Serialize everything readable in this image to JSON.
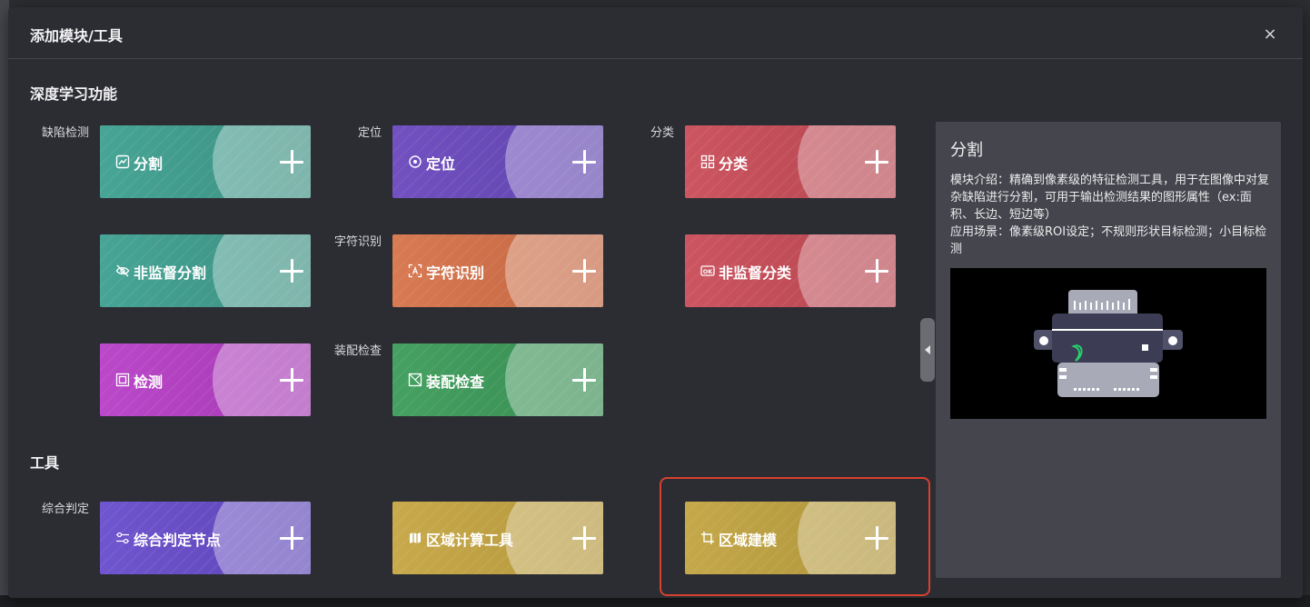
{
  "dialog": {
    "title": "添加模块/工具",
    "close_label": "×"
  },
  "sections": {
    "deep_learning": "深度学习功能",
    "tools": "工具"
  },
  "groups": {
    "defect": "缺陷检测",
    "locate": "定位",
    "classify": "分类",
    "ocr": "字符识别",
    "assembly": "装配检查",
    "judge": "综合判定"
  },
  "cards": {
    "segment": {
      "label": "分割",
      "icon": "segment-icon",
      "color": "#3f9b8c"
    },
    "locate": {
      "label": "定位",
      "icon": "target-icon",
      "color": "#6b4fb8"
    },
    "classify": {
      "label": "分类",
      "icon": "grid-icon",
      "color": "#c44d57"
    },
    "unsup_segment": {
      "label": "非监督分割",
      "icon": "eye-off-icon",
      "color": "#3f9b8c"
    },
    "ocr": {
      "label": "字符识别",
      "icon": "text-scan-icon",
      "color": "#d66f47"
    },
    "unsup_classify": {
      "label": "非监督分类",
      "icon": "ok-badge-icon",
      "color": "#c44d57"
    },
    "detect": {
      "label": "检测",
      "icon": "frame-icon",
      "color": "#b23fc0"
    },
    "assembly": {
      "label": "装配检查",
      "icon": "box-check-icon",
      "color": "#3e9a5b"
    },
    "judge_node": {
      "label": "综合判定节点",
      "icon": "sliders-icon",
      "color": "#6a50c8"
    },
    "area_calc": {
      "label": "区域计算工具",
      "icon": "map-icon",
      "color": "#c2a343"
    },
    "area_model": {
      "label": "区域建模",
      "icon": "crop-icon",
      "color": "#bca13e"
    }
  },
  "info": {
    "title": "分割",
    "desc_1": "模块介绍：精确到像素级的特征检测工具，用于在图像中对复杂缺陷进行分割，可用于输出检测结果的图形属性（ex:面积、长边、短边等）",
    "desc_2": "应用场景：像素级ROI设定；不规则形状目标检测；小目标检测",
    "image": "connector-defect-preview"
  },
  "colors": {
    "highlight": "#d8402e",
    "panel": "#45464d",
    "dialog": "#2c2d33"
  }
}
